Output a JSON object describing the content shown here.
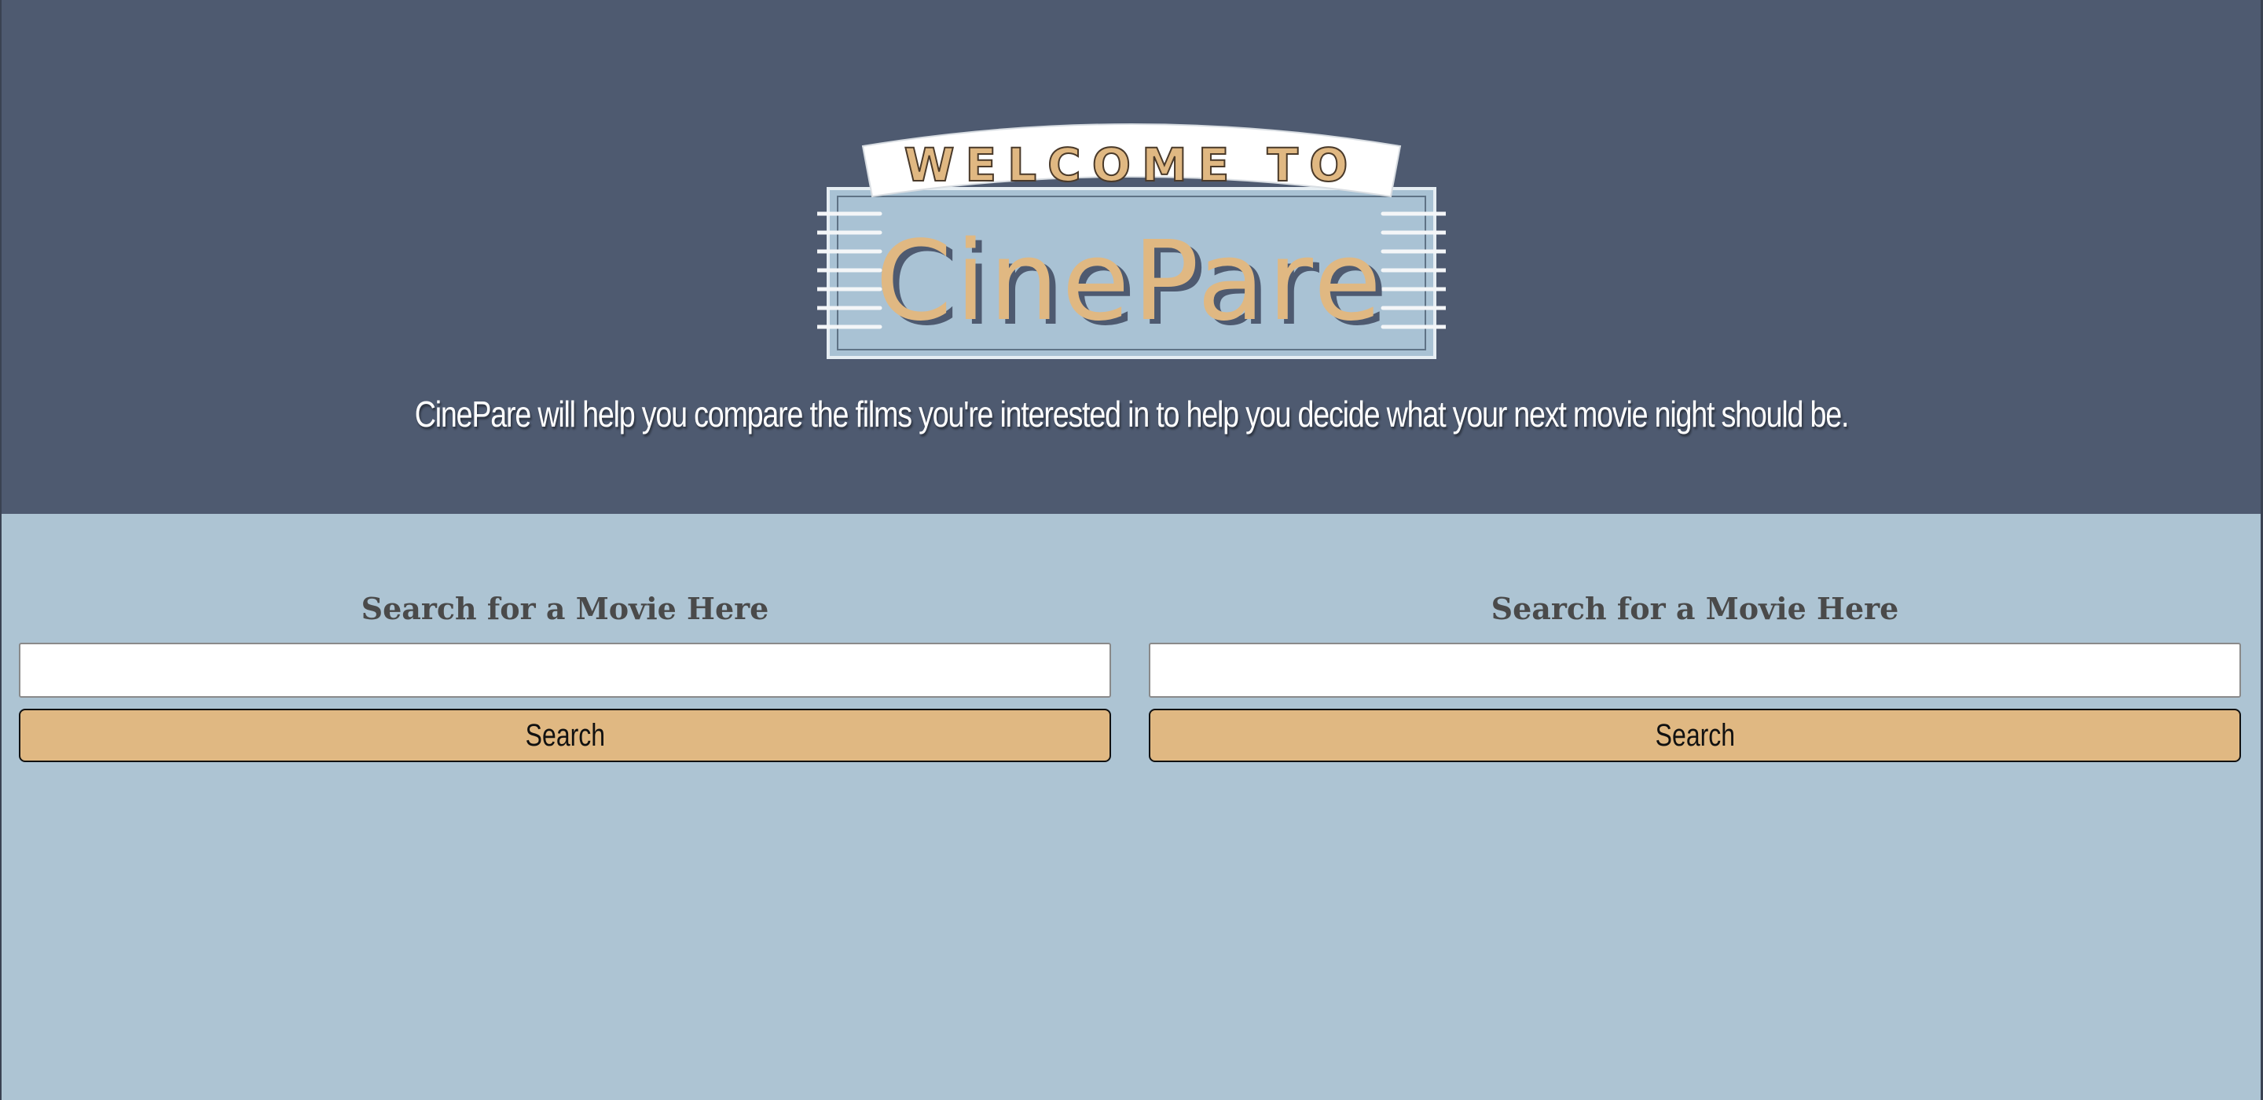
{
  "colors": {
    "header_bg": "#4e5a70",
    "page_bg": "#adc4d3",
    "button_bg": "#e0b882",
    "logo_accent": "#e0b882",
    "logo_panel": "#a9c2d4"
  },
  "logo": {
    "banner_text": "WELCOME TO",
    "brand_text": "CinePare"
  },
  "tagline": "CinePare will help you compare the films you're interested in to help you decide what your next movie night should be.",
  "search_left": {
    "heading": "Search for a Movie Here",
    "input_value": "",
    "button_label": "Search"
  },
  "search_right": {
    "heading": "Search for a Movie Here",
    "input_value": "",
    "button_label": "Search"
  }
}
